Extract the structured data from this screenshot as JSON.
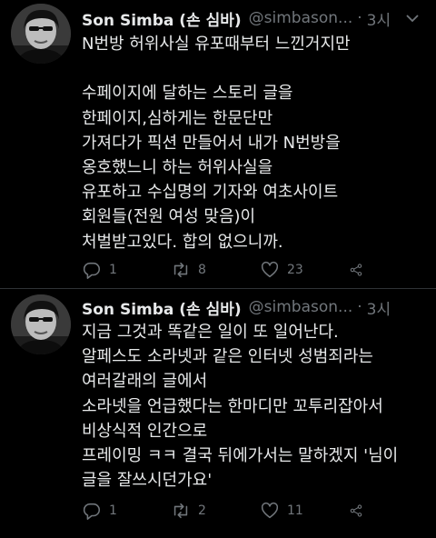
{
  "tweets": [
    {
      "author_name": "Son Simba (손 심바)",
      "handle": "@simbason...",
      "separator": "·",
      "time": "3시",
      "text": "N번방 허위사실 유포때부터 느낀거지만\n\n수페이지에 달하는 스토리 글을\n한페이지,심하게는 한문단만\n가져다가 픽션 만들어서 내가 N번방을\n옹호했느니 하는 허위사실을\n유포하고 수십명의 기자와 여초사이트\n회원들(전원 여성 맞음)이\n처벌받고있다. 합의 없으니까.",
      "reply_count": "1",
      "retweet_count": "8",
      "like_count": "23"
    },
    {
      "author_name": "Son Simba (손 심바)",
      "handle": "@simbason...",
      "separator": "·",
      "time": "3시",
      "text": "지금 그것과 똑같은 일이 또 일어난다.\n알페스도 소라넷과 같은 인터넷 성범죄라는\n여러갈래의 글에서\n소라넷을 언급했다는 한마디만 꼬투리잡아서\n비상식적 인간으로\n프레이밍 ㅋㅋ 결국 뒤에가서는 말하겠지 '님이\n글을 잘쓰시던가요'",
      "reply_count": "1",
      "retweet_count": "2",
      "like_count": "11"
    }
  ],
  "icons": {
    "reply": "reply-icon",
    "retweet": "retweet-icon",
    "like": "heart-icon",
    "share": "share-icon",
    "more": "chevron-down-icon"
  },
  "colors": {
    "background": "#000000",
    "text": "#e7e9ea",
    "secondary": "#71767b",
    "divider": "#2f3336"
  }
}
